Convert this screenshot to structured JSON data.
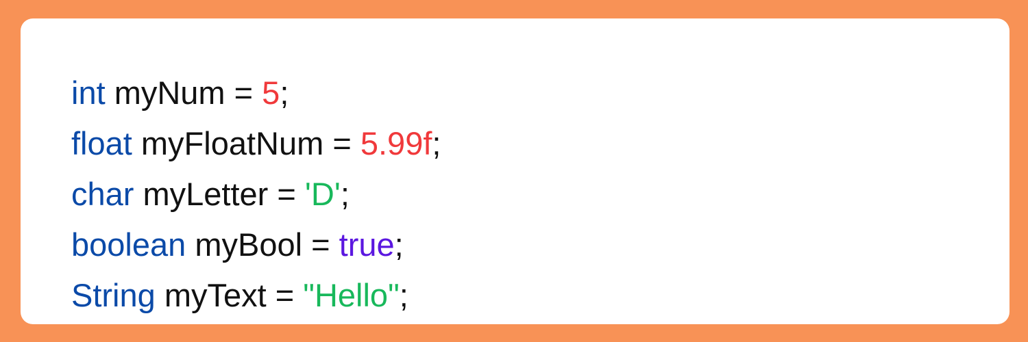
{
  "code_snippet": {
    "lines": [
      {
        "type": "int",
        "name": "myNum",
        "op": "=",
        "value": "5",
        "value_kind": "number",
        "end": ";"
      },
      {
        "type": "float",
        "name": "myFloatNum",
        "op": "=",
        "value": "5.99f",
        "value_kind": "number",
        "end": ";"
      },
      {
        "type": "char",
        "name": "myLetter",
        "op": "=",
        "value": "'D'",
        "value_kind": "string",
        "end": ";"
      },
      {
        "type": "boolean",
        "name": "myBool",
        "op": "=",
        "value": "true",
        "value_kind": "keyword",
        "end": ";"
      },
      {
        "type": "String",
        "name": "myText",
        "op": "=",
        "value": "\"Hello\"",
        "value_kind": "string",
        "end": ";"
      }
    ]
  },
  "colors": {
    "background": "#F89256",
    "card": "#FFFFFF",
    "type_keyword": "#0B4AA8",
    "identifier": "#111111",
    "number_literal": "#F0393B",
    "string_literal": "#18B85B",
    "boolean_literal": "#5B17E0"
  }
}
